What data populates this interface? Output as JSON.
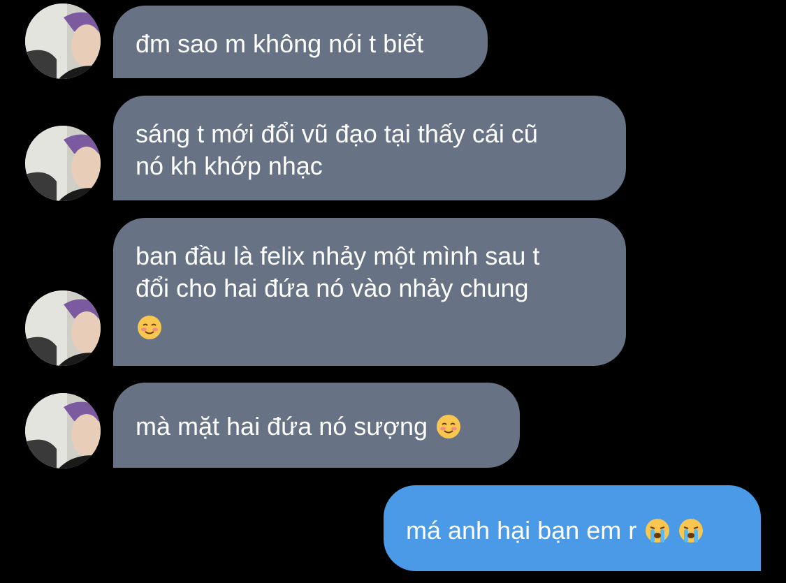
{
  "conversation": {
    "messages": [
      {
        "sender": "contact",
        "text": "đm sao m không nói t biết"
      },
      {
        "sender": "contact",
        "lines": [
          "sáng t mới đổi vũ đạo tại thấy cái cũ",
          "nó kh khớp nhạc"
        ]
      },
      {
        "sender": "contact",
        "lines": [
          "ban đầu là felix nhảy một mình sau t",
          "đổi cho hai đứa nó vào nhảy chung"
        ],
        "emoji": "smiling-face-icon"
      },
      {
        "sender": "contact",
        "text": "mà mặt hai đứa nó sượng",
        "emoji": "smiling-face-icon"
      },
      {
        "sender": "me",
        "text": "má anh hại bạn em r",
        "emojis": [
          "loudly-crying-face-icon",
          "loudly-crying-face-icon"
        ]
      }
    ]
  },
  "colors": {
    "background": "#000000",
    "incoming_bubble": "#677384",
    "outgoing_bubble": "#4a9ae7",
    "text": "#ffffff"
  }
}
